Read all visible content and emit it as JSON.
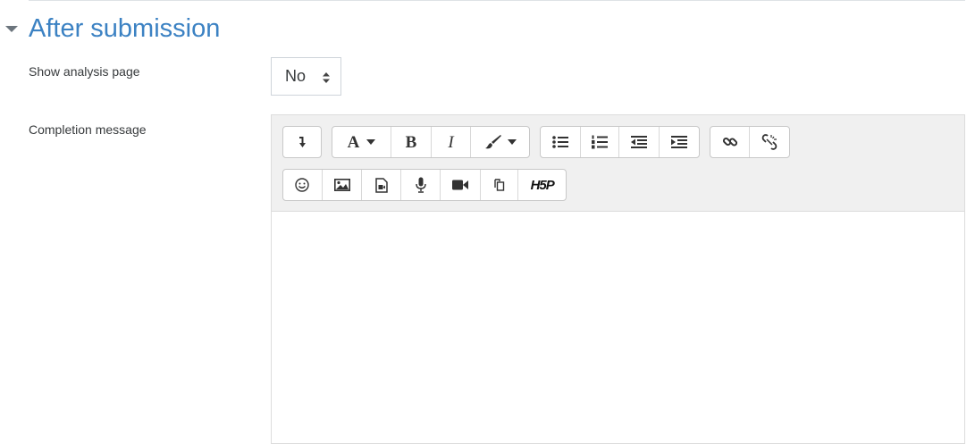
{
  "section": {
    "title": "After submission",
    "toggle_icon": "caret-down-icon"
  },
  "fields": {
    "show_analysis": {
      "label": "Show analysis page",
      "value": "No"
    },
    "completion_message": {
      "label": "Completion message",
      "content": ""
    }
  },
  "colors": {
    "title": "#3c82c3",
    "toolbar_bg": "#f0f0f0"
  },
  "toolbar": {
    "row1": [
      [
        "collapse-toolbar-icon"
      ],
      [
        "font-style-icon",
        "bold-icon",
        "italic-icon",
        "text-color-icon"
      ],
      [
        "unordered-list-icon",
        "ordered-list-icon",
        "outdent-icon",
        "indent-icon"
      ],
      [
        "link-icon",
        "unlink-icon"
      ]
    ],
    "row2": [
      [
        "emoji-icon",
        "image-icon",
        "media-icon",
        "record-audio-icon",
        "record-video-icon",
        "manage-files-icon",
        "h5p-icon"
      ]
    ],
    "font_button_glyph": "A",
    "bold_glyph": "B",
    "italic_glyph": "I",
    "h5p_glyph": "H5P"
  }
}
